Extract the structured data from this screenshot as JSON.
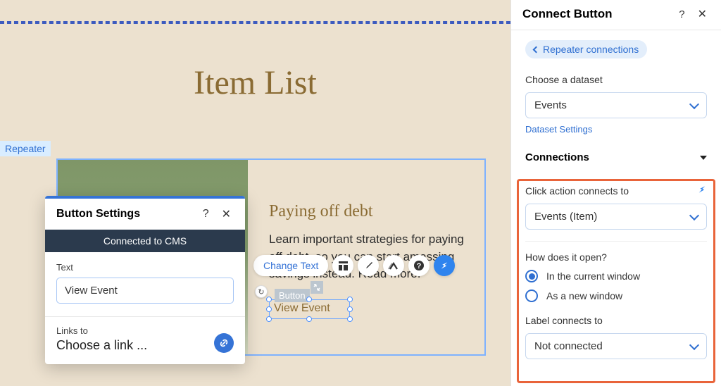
{
  "canvas": {
    "title": "Item List",
    "repeater_tag": "Repeater",
    "card": {
      "heading": "Paying off debt",
      "body": "Learn important strategies for paying off debt, so you can start amassing savings instead. Read more."
    },
    "button_tag": "Button",
    "button_label": "View Event"
  },
  "action_bar": {
    "change_text": "Change Text"
  },
  "button_settings": {
    "title": "Button Settings",
    "connected": "Connected to CMS",
    "text_label": "Text",
    "text_value": "View Event",
    "links_to_label": "Links to",
    "choose_link": "Choose a link ..."
  },
  "sidebar": {
    "title": "Connect Button",
    "back_chip": "Repeater connections",
    "choose_dataset_label": "Choose a dataset",
    "dataset_value": "Events",
    "dataset_settings": "Dataset Settings",
    "connections_title": "Connections",
    "click_action_label": "Click action connects to",
    "click_action_value": "Events (Item)",
    "how_open_label": "How does it open?",
    "open_current": "In the current window",
    "open_new": "As a new window",
    "label_connects_label": "Label connects to",
    "label_connects_value": "Not connected"
  }
}
